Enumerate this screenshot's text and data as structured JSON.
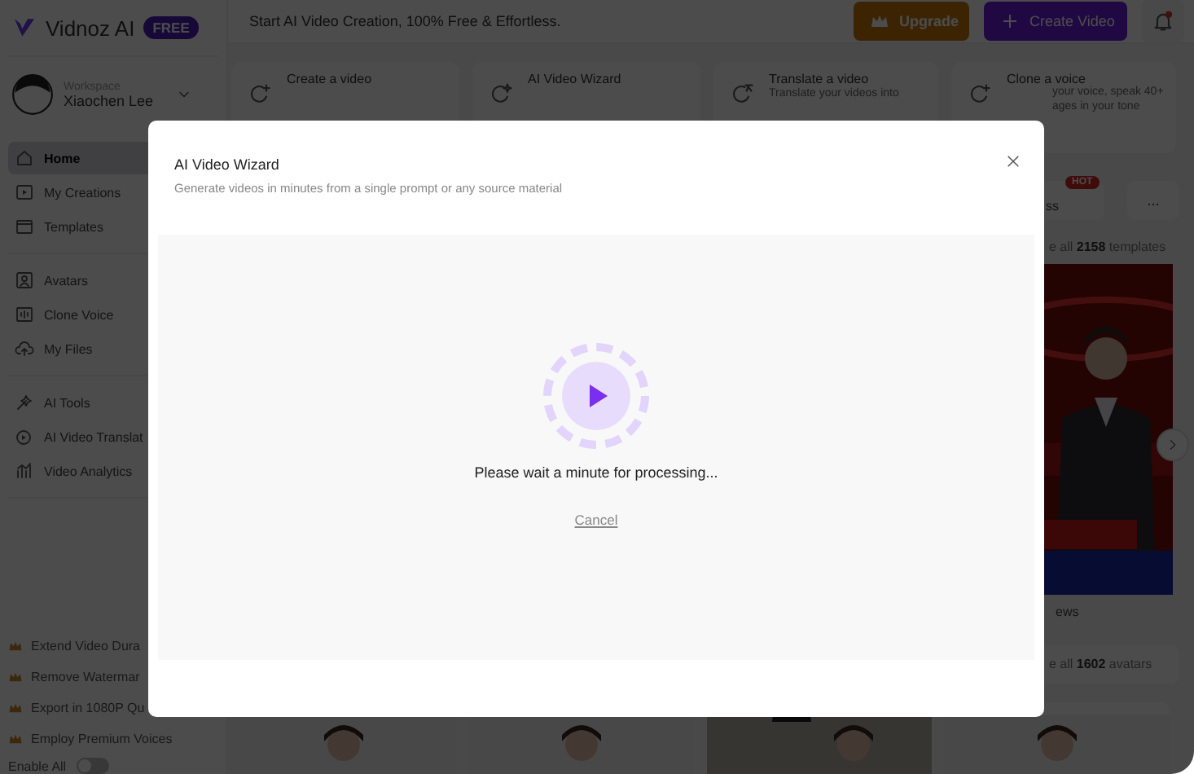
{
  "app": {
    "logo": "Vidnoz AI",
    "plan_badge": "FREE",
    "tagline": "Start AI Video Creation, 100% Free & Effortless."
  },
  "header_buttons": [
    {
      "kind": "upgrade",
      "label": "Upgrade"
    },
    {
      "kind": "create",
      "label": "Create Video"
    }
  ],
  "notifications": {
    "unread": true
  },
  "workspace": {
    "caption": "Workspace",
    "user": "Xiaochen Lee"
  },
  "sidebar": {
    "groups": [
      [
        {
          "label": "Home",
          "selected": true
        },
        {
          "label": "My Creations",
          "selected": false
        },
        {
          "label": "Templates",
          "selected": false
        }
      ],
      [
        {
          "label": "Avatars",
          "selected": false
        },
        {
          "label": "Clone Voice",
          "selected": false
        },
        {
          "label": "My Files",
          "selected": false
        }
      ],
      [
        {
          "label": "AI Tools",
          "selected": false
        },
        {
          "label": "AI Video Translat",
          "selected": false
        },
        {
          "label": "Video Analytics",
          "selected": false
        }
      ]
    ],
    "perks": [
      "Extend Video Dura",
      "Remove Watermar",
      "Export in 1080P Qu",
      "Employ Premium Voices"
    ],
    "enable_all": {
      "label": "Enable All",
      "on": false
    }
  },
  "quick_actions": [
    {
      "title": "Create a video"
    },
    {
      "title": "AI Video Wizard"
    },
    {
      "title": "Translate a video",
      "lines": [
        "Translate your videos into"
      ]
    },
    {
      "title": "Clone a voice",
      "lines": [
        "your voice, speak 40+",
        "ages in your tone"
      ]
    }
  ],
  "template_tabs": {
    "tab": "ss",
    "badge": "HOT",
    "more": "..."
  },
  "templates": {
    "summary": "e all **2158** templates",
    "caption": "ews"
  },
  "avatars": {
    "summary": "e all **1602** avatars"
  },
  "dialog": {
    "title": "AI Video Wizard",
    "subtitle": "Generate videos in minutes from a single prompt or any source material",
    "status": "Please wait a minute for processing...",
    "cancel": "Cancel"
  }
}
